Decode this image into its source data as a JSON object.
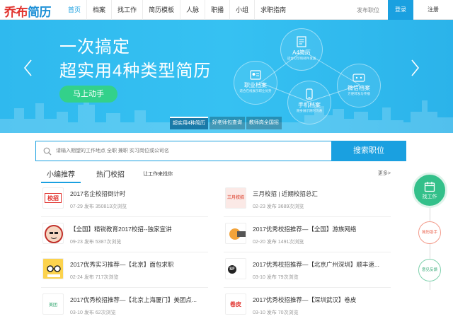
{
  "logo": {
    "part1": "乔布",
    "part2": "简历"
  },
  "nav": {
    "items": [
      "首页",
      "档案",
      "找工作",
      "简历模板",
      "人脉",
      "职播",
      "小组",
      "求职指南"
    ],
    "post_job": "发布职位",
    "login": "登录",
    "register": "注册"
  },
  "banner": {
    "headline1": "一次搞定",
    "headline2": "超实用4种类型简历",
    "cta": "马上动手",
    "bubbles": [
      {
        "title": "A4简历",
        "sub": "适合打印和邮件发送",
        "icon": "document-icon"
      },
      {
        "title": "职业档案",
        "sub": "适合在线展示职业优势",
        "icon": "profile-card-icon"
      },
      {
        "title": "微信档案",
        "sub": "方便转发与传播",
        "icon": "wechat-icon"
      },
      {
        "title": "手机档案",
        "sub": "随身展示随时沟通",
        "icon": "phone-icon"
      }
    ],
    "tabs": [
      "超实用4种简历",
      "好老师包查询",
      "教师岗全国招"
    ]
  },
  "search": {
    "placeholder": "请输入期望的工作地点 全职 兼职 实习岗位或公司名",
    "button": "搜索职位"
  },
  "content_tabs": {
    "tab1": "小编推荐",
    "tab2": "热门校招",
    "tab3": "让工作来找你",
    "more": "更多>"
  },
  "articles": [
    {
      "title": "2017名企校招倒计时",
      "meta": "07-29 发布   350813次浏览",
      "thumb": "校招"
    },
    {
      "title": "三月校招 | 近期校招总汇",
      "meta": "02-23 发布   3689次浏览",
      "thumb": "三月校招"
    },
    {
      "title": "【全国】精锐教育2017校招--独家宣讲",
      "meta": "09-23 发布   5387次浏览",
      "thumb": "精锐"
    },
    {
      "title": "2017优秀校招推荐—【全国】游族网络",
      "meta": "02-20 发布   1491次浏览",
      "thumb": "游族"
    },
    {
      "title": "2017优秀实习推荐—【北京】面包求职",
      "meta": "02-24 发布   717次浏览",
      "thumb": "面包求职"
    },
    {
      "title": "2017优秀校招推荐—【北京广州深圳】顺丰速...",
      "meta": "03-10 发布   79次浏览",
      "thumb": "SF"
    },
    {
      "title": "2017优秀校招推荐—【北京上海厦门】美团点...",
      "meta": "03-10 发布   62次浏览",
      "thumb": "美团"
    },
    {
      "title": "2017优秀校招推荐—【深圳武汉】卷皮",
      "meta": "03-10 发布   70次浏览",
      "thumb": "卷皮"
    }
  ],
  "side": {
    "main": "找工作",
    "resume": "简历助手",
    "feedback": "意见反馈"
  },
  "colors": {
    "brand": "#1aa0e0",
    "accent_green": "#33c08a",
    "logo_red": "#e1322d"
  }
}
